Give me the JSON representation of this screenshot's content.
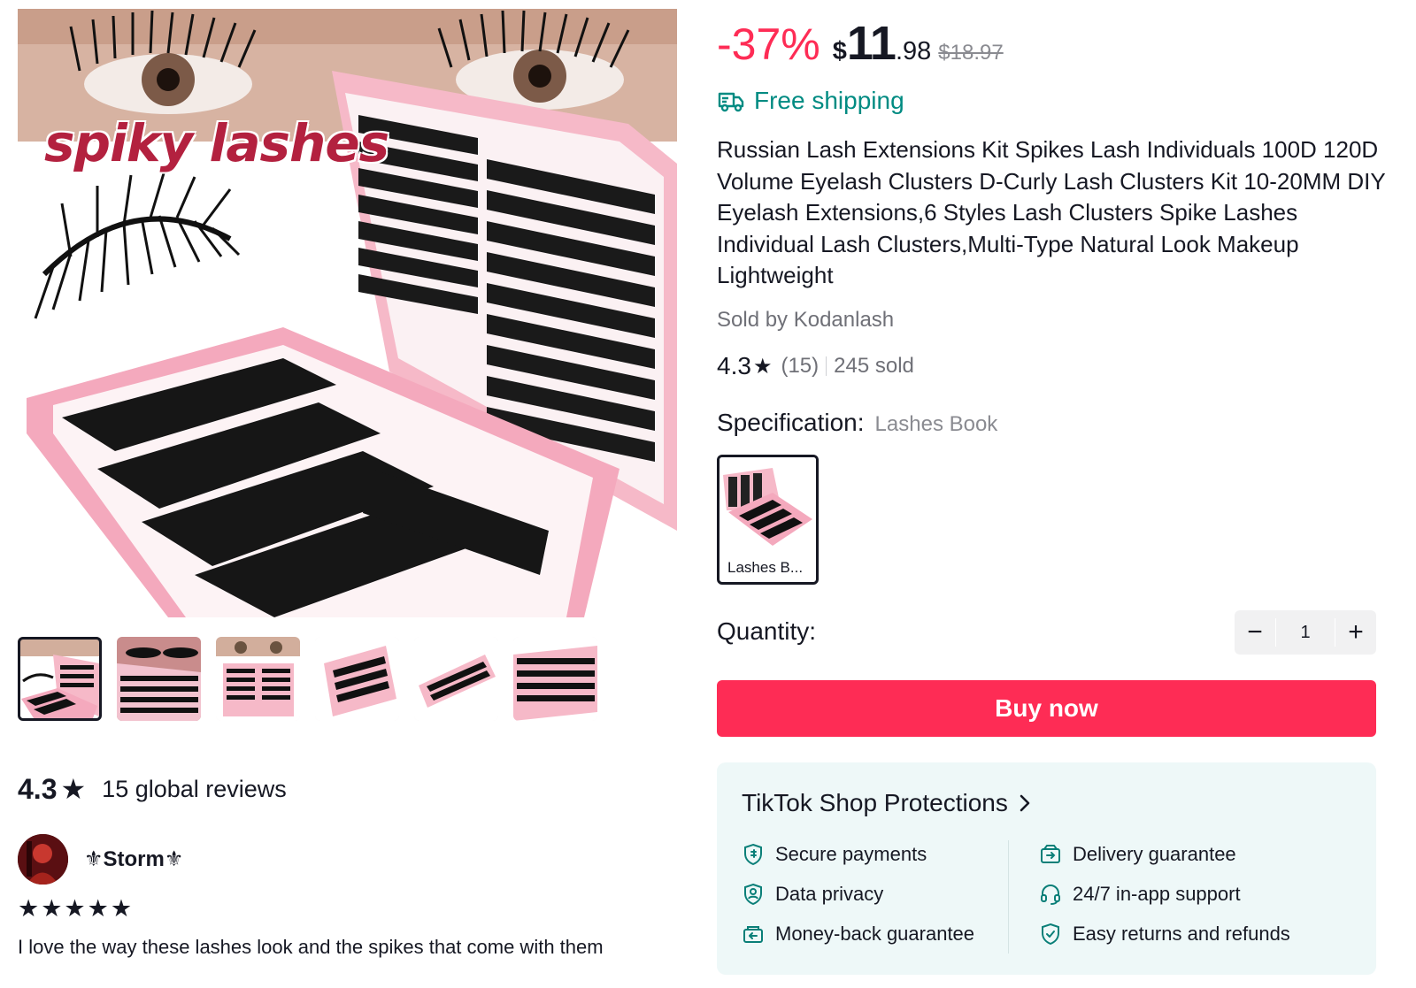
{
  "product_images": {
    "main_caption": "spiky lashes",
    "thumbnail_count": 6
  },
  "price": {
    "discount": "-37%",
    "currency": "$",
    "integer": "11",
    "decimal": ".98",
    "original": "$18.97"
  },
  "shipping": {
    "label": "Free shipping",
    "icon": "truck-icon",
    "color": "#008b82"
  },
  "title": "Russian Lash Extensions Kit Spikes Lash Individuals 100D 120D Volume Eyelash Clusters D-Curly Lash Clusters Kit 10-20MM DIY Eyelash Extensions,6 Styles Lash Clusters Spike Lashes Individual Lash Clusters,Multi-Type Natural Look Makeup Lightweight",
  "seller": {
    "label": "Sold by Kodanlash"
  },
  "rating": {
    "score": "4.3",
    "count": "(15)",
    "sold": "245 sold"
  },
  "specification": {
    "label": "Specification:",
    "value": "Lashes Book",
    "options": [
      {
        "label": "Lashes B..."
      }
    ]
  },
  "quantity": {
    "label": "Quantity:",
    "value": "1",
    "minus": "−",
    "plus": "+"
  },
  "buy_button": {
    "label": "Buy now",
    "color": "#fe2c55"
  },
  "protections": {
    "title": "TikTok Shop Protections",
    "items": [
      {
        "label": "Secure payments",
        "icon": "shield-payment-icon"
      },
      {
        "label": "Data privacy",
        "icon": "shield-user-icon"
      },
      {
        "label": "Money-back guarantee",
        "icon": "money-back-icon"
      },
      {
        "label": "Delivery guarantee",
        "icon": "delivery-box-icon"
      },
      {
        "label": "24/7 in-app support",
        "icon": "headset-icon"
      },
      {
        "label": "Easy returns and refunds",
        "icon": "shield-check-icon"
      }
    ]
  },
  "reviews": {
    "score": "4.3",
    "star": "★",
    "summary": "15 global reviews",
    "items": [
      {
        "author": "⚜Storm⚜",
        "stars": "★★★★★",
        "text": "I love the way these lashes look and the spikes that come with them"
      }
    ]
  }
}
